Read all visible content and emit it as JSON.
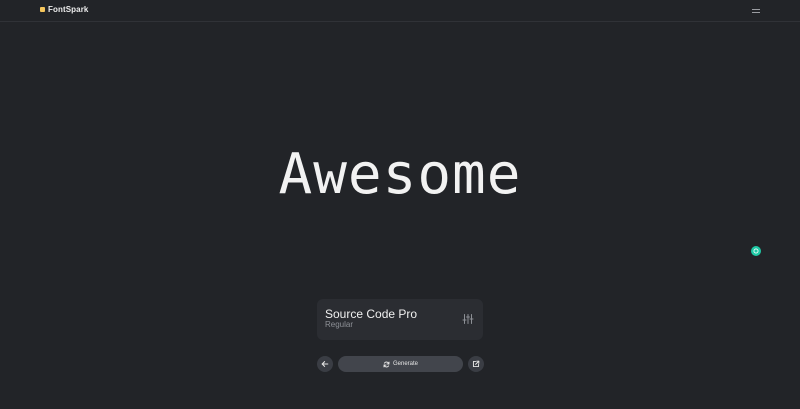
{
  "header": {
    "brand_name": "FontSpark",
    "menu_icon": "hamburger-menu-icon"
  },
  "preview": {
    "text": "Awesome"
  },
  "font_card": {
    "name": "Source Code Pro",
    "style": "Regular",
    "settings_icon": "sliders-icon"
  },
  "controls": {
    "back_icon": "arrow-left-icon",
    "generate_label": "Generate",
    "generate_icon": "refresh-icon",
    "share_icon": "external-link-icon"
  },
  "chat": {
    "icon": "chat-icon"
  },
  "colors": {
    "background": "#222428",
    "brand_accent": "#f5c65c",
    "chat_accent": "#1fc9a6",
    "card": "#2b2d32",
    "button": "#42454c"
  }
}
